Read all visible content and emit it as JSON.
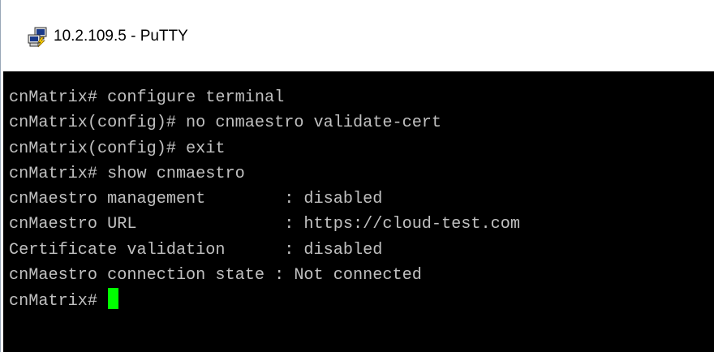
{
  "window": {
    "title": "10.2.109.5 - PuTTY",
    "icon": "putty-icon"
  },
  "terminal": {
    "background": "#000000",
    "foreground": "#c0c0c0",
    "cursor_color": "#00ff00",
    "lines": [
      "cnMatrix# configure terminal",
      "cnMatrix(config)# no cnmaestro validate-cert",
      "cnMatrix(config)# exit",
      "cnMatrix# show cnmaestro",
      "cnMaestro management        : disabled",
      "cnMaestro URL               : https://cloud-test.com",
      "Certificate validation      : disabled",
      "cnMaestro connection state : Not connected"
    ],
    "prompt": "cnMatrix# "
  }
}
